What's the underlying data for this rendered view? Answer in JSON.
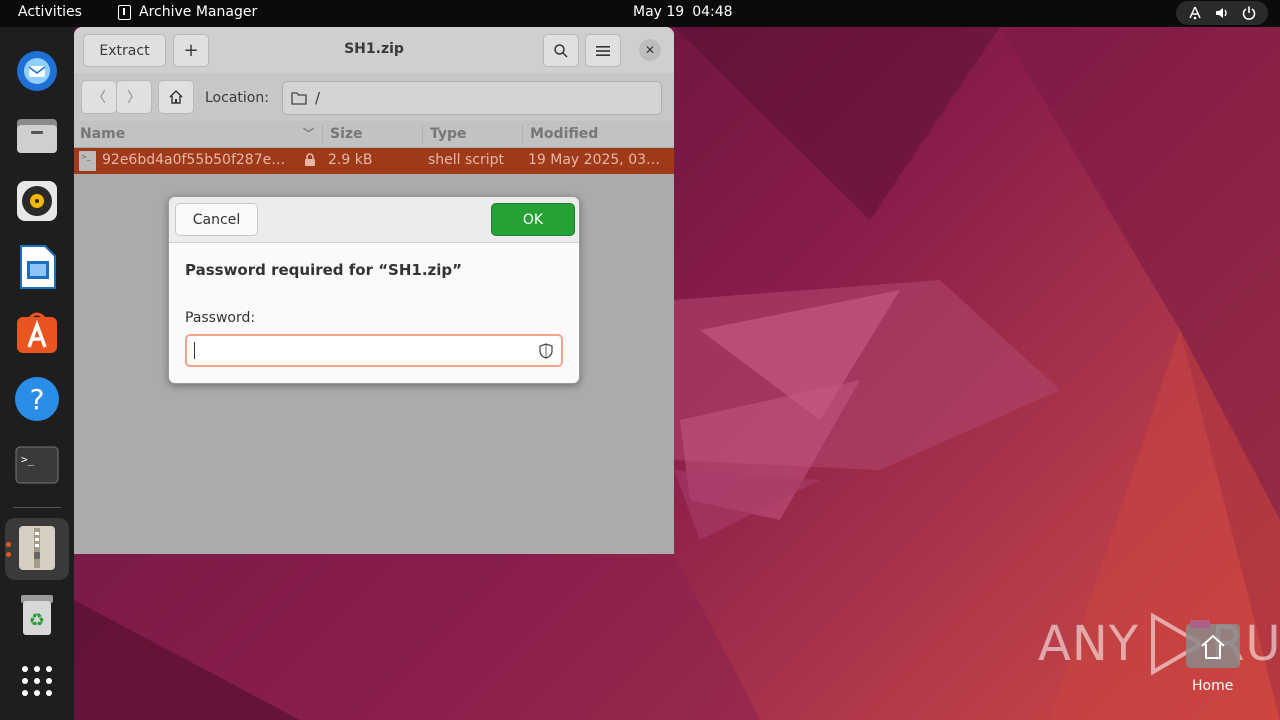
{
  "topbar": {
    "activities": "Activities",
    "app_name": "Archive Manager",
    "date": "May 19",
    "time": "04:48"
  },
  "dock": {
    "items": [
      "Thunderbird Mail",
      "Files",
      "Rhythmbox",
      "LibreOffice Writer",
      "Ubuntu Software",
      "Help",
      "Terminal",
      "Archive Manager",
      "Trash",
      "Show Applications"
    ],
    "active": "Archive Manager"
  },
  "window": {
    "extract_label": "Extract",
    "title": "SH1.zip",
    "location_label": "Location:",
    "location_value": "/",
    "columns": [
      "Name",
      "Size",
      "Type",
      "Modified"
    ],
    "files": [
      {
        "name": "92e6bd4a0f55b50f287e…",
        "size": "2.9 kB",
        "type": "shell script",
        "modified": "19 May 2025, 03…",
        "encrypted": true
      }
    ]
  },
  "dialog": {
    "cancel_label": "Cancel",
    "ok_label": "OK",
    "heading": "Password required for “SH1.zip”",
    "password_label": "Password:",
    "password_value": ""
  },
  "desktop": {
    "watermark_left": "ANY",
    "watermark_right": "RUN",
    "home_label": "Home"
  },
  "colors": {
    "selection": "#9e3a1a",
    "ok_button": "#26a136",
    "accent": "#e95420"
  }
}
